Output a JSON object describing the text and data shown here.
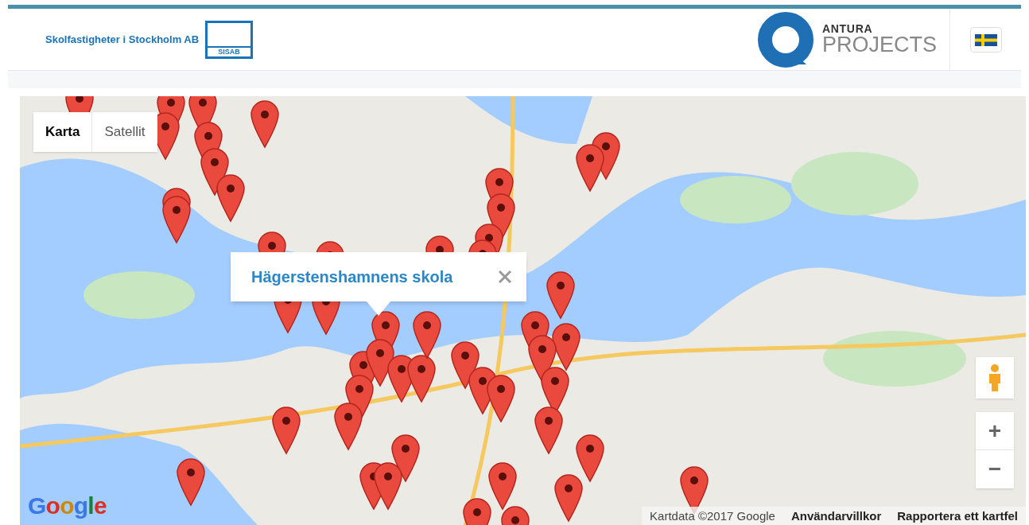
{
  "header": {
    "company_name": "Skolfastigheter i Stockholm AB",
    "company_logo_text": "SISAB",
    "product_brand": "ANTURA",
    "product_name": "PROJECTS"
  },
  "map": {
    "map_type_tabs": [
      {
        "label": "Karta",
        "selected": true
      },
      {
        "label": "Satellit",
        "selected": false
      }
    ],
    "info_window": {
      "title": "Hägerstenshamnens skola"
    },
    "zoom_controls": [
      "+",
      "−"
    ],
    "logo": "Google",
    "attribution": [
      {
        "kind": "text",
        "label": "Kartdata ©2017 Google"
      },
      {
        "kind": "link",
        "label": "Användarvillkor"
      },
      {
        "kind": "link",
        "label": "Rapportera ett kartfel"
      }
    ]
  }
}
